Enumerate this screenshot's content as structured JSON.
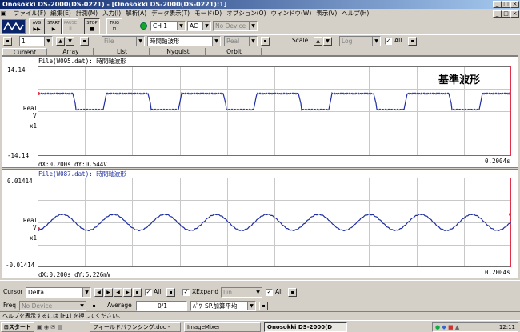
{
  "window": {
    "title": "Onosokki DS-2000(DS-0221) - [Onosokki DS-2000(DS-0221):1]",
    "controls": [
      "_",
      "□",
      "×"
    ],
    "inner_controls": [
      "_",
      "□",
      "×"
    ]
  },
  "menu": [
    "ファイル(F)",
    "編集(E)",
    "計測(M)",
    "入力(I)",
    "解析(A)",
    "データ表示(T)",
    "モード(D)",
    "オプション(O)",
    "ウィンドウ(W)",
    "表示(V)",
    "ヘルプ(H)"
  ],
  "toolbar": {
    "buttons": [
      {
        "label": "AVG",
        "icon": "▶▶"
      },
      {
        "label": "START",
        "icon": "▶"
      },
      {
        "label": "PAUSE",
        "icon": "II"
      },
      {
        "label": "STOP",
        "icon": "■"
      },
      {
        "label": "TRIG",
        "icon": "⊓"
      }
    ],
    "channel": "CH 1",
    "coupling": "AC",
    "device": "No Device"
  },
  "toolbar2": {
    "page": "1",
    "file": "File",
    "data_type": "時間軸波形",
    "format": "Real",
    "scale_label": "Scale",
    "scale_value": "Log",
    "all_label": "All",
    "all_checked": true
  },
  "tabs": [
    "Current",
    "Array",
    "List",
    "Nyquist",
    "Orbit"
  ],
  "graph1": {
    "file_label": "File(W095.dat): 時間軸波形",
    "y_max": "14.14",
    "y_min": "-14.14",
    "y_name": "Real",
    "y_sub": "V",
    "y_mult": "x1",
    "cursor_readout": "dX:0.200s dY:0.544V",
    "x_end": "0.2004s",
    "annotation": "基準波形",
    "wave_color": "#1f2fa0"
  },
  "graph2": {
    "file_label": "File(W087.dat): 時間軸波形",
    "y_max": "0.01414",
    "y_min": "-0.01414",
    "y_name": "Real",
    "y_sub": "V",
    "y_mult": "x1",
    "cursor_readout": "dX:0.200s dY:5.226mV",
    "x_end": "0.2004s",
    "wave_color": "#1f2fa0"
  },
  "bottom": {
    "cursor_label": "Cursor",
    "cursor_value": "Delta",
    "all_label": "All",
    "xexpand_label": "XExpand",
    "xexpand_value": "Lin",
    "all2_label": "All",
    "freq_label": "Freq",
    "freq_value": "No Device",
    "average_label": "Average",
    "average_value": "0/1",
    "average_mode": "ﾊﾟﾜｰSP.加算平均"
  },
  "status": "ヘルプを表示するには [F1] を押してください。",
  "taskbar": {
    "start": "スタート",
    "tasks": [
      "フィールドバランシング.doc -",
      "ImageMixer",
      "Onosokki DS-2000(D"
    ],
    "clock": "12:11"
  }
}
